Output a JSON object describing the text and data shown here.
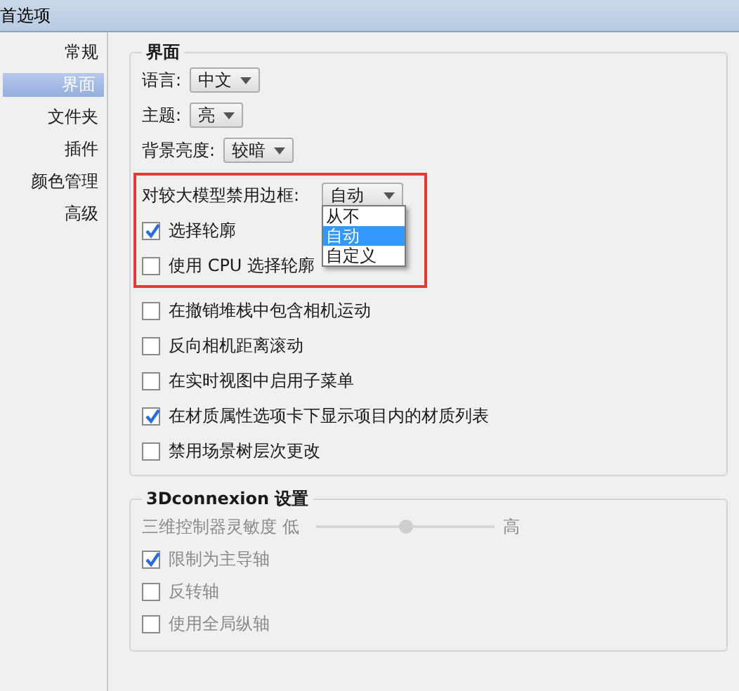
{
  "window": {
    "title": "首选项"
  },
  "sidebar": {
    "items": [
      {
        "label": "常规",
        "selected": false
      },
      {
        "label": "界面",
        "selected": true
      },
      {
        "label": "文件夹",
        "selected": false
      },
      {
        "label": "插件",
        "selected": false
      },
      {
        "label": "颜色管理",
        "selected": false
      },
      {
        "label": "高级",
        "selected": false
      }
    ]
  },
  "interface_group": {
    "title": "界面",
    "selects": [
      {
        "label": "语言:",
        "value": "中文"
      },
      {
        "label": "主题:",
        "value": "亮"
      },
      {
        "label": "背景亮度:",
        "value": "较暗"
      }
    ],
    "highlighted": {
      "select": {
        "label": "对较大模型禁用边框:",
        "value": "自动",
        "expanded": true,
        "options": [
          {
            "label": "从不",
            "selected": false
          },
          {
            "label": "自动",
            "selected": true
          },
          {
            "label": "自定义",
            "selected": false
          }
        ]
      },
      "checkboxes": [
        {
          "label": "选择轮廓",
          "checked": true
        },
        {
          "label": "使用 CPU 选择轮廓",
          "checked": false
        }
      ]
    },
    "checkboxes": [
      {
        "label": "在撤销堆栈中包含相机运动",
        "checked": false
      },
      {
        "label": "反向相机距离滚动",
        "checked": false
      },
      {
        "label": "在实时视图中启用子菜单",
        "checked": false
      },
      {
        "label": "在材质属性选项卡下显示项目内的材质列表",
        "checked": true
      },
      {
        "label": "禁用场景树层次更改",
        "checked": false
      }
    ]
  },
  "connexion_group": {
    "title": "3Dconnexion 设置",
    "disabled": true,
    "slider": {
      "label": "三维控制器灵敏度",
      "min_label": "低",
      "max_label": "高",
      "level": 0.5
    },
    "checkboxes": [
      {
        "label": "限制为主导轴",
        "checked": true
      },
      {
        "label": "反转轴",
        "checked": false
      },
      {
        "label": "使用全局纵轴",
        "checked": false
      }
    ]
  }
}
